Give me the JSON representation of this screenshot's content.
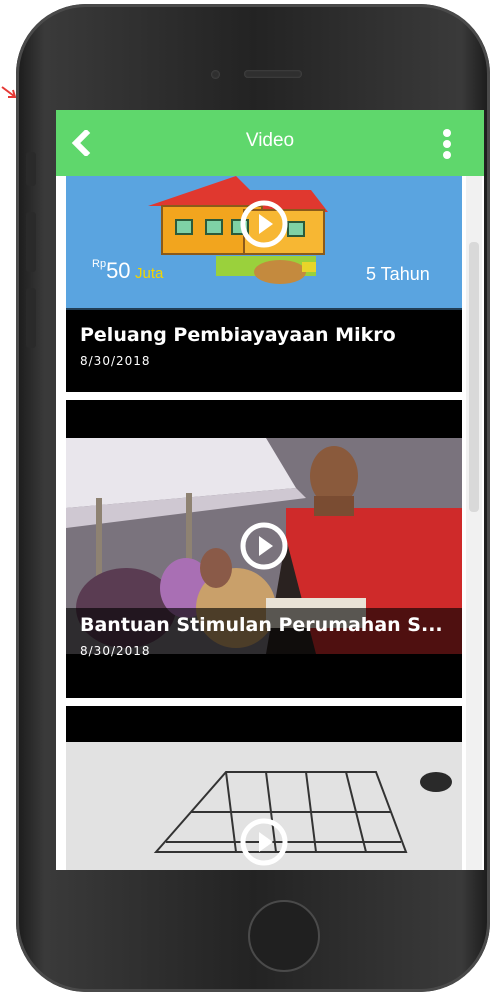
{
  "appbar": {
    "title": "Video",
    "back_icon": "chevron-left-icon",
    "more_icon": "more-vertical-icon",
    "color": "#5fd76c"
  },
  "videos": [
    {
      "title": "Peluang Pembiayayaan Mikro",
      "date": "8/30/2018",
      "thumb_text": {
        "price_prefix": "Rp",
        "price": "50",
        "price_unit": "Juta",
        "term": "5 Tahun"
      }
    },
    {
      "title": "Bantuan Stimulan Perumahan S...",
      "date": "8/30/2018"
    },
    {
      "title": "",
      "date": ""
    }
  ],
  "colors": {
    "accent": "#5fd76c",
    "card_bg": "#000000",
    "thumb1_bg": "#5aa4e0"
  }
}
